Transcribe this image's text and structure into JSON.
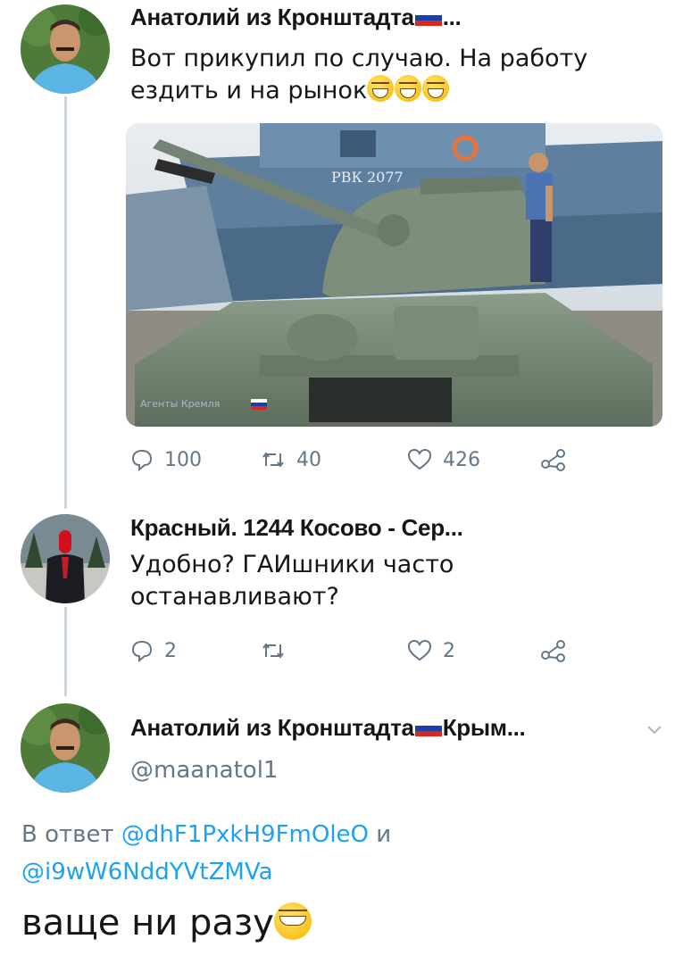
{
  "tweets": [
    {
      "author": "Анатолий из Кронштадта",
      "author_suffix": "...",
      "text_line1": "Вот прикупил по случаю. На работу",
      "text_line2": "ездить и на рынок",
      "media_caption": "Агенты Кремля",
      "media_hull_number": "РВК 2077",
      "replies": "100",
      "retweets": "40",
      "likes": "426"
    },
    {
      "author": "Красный. 1244 Косово - Сер...",
      "text_line1": "Удобно? ГАИшники часто",
      "text_line2": "останавливают?",
      "replies": "2",
      "retweets": "",
      "likes": "2"
    }
  ],
  "main_tweet": {
    "author": "Анатолий из Кронштадта",
    "author_suffix": "Крым...",
    "handle": "@maanatol1",
    "reply_prefix": "В ответ",
    "reply_to_1": "@dhF1PxkH9FmOleO",
    "reply_conjunction": "и",
    "reply_to_2": "@i9wW6NddYVtZMVa",
    "text": "ваще ни разу"
  },
  "colors": {
    "accent": "#1da1f2",
    "muted": "#657786",
    "thread_line": "#ccd6dd"
  }
}
